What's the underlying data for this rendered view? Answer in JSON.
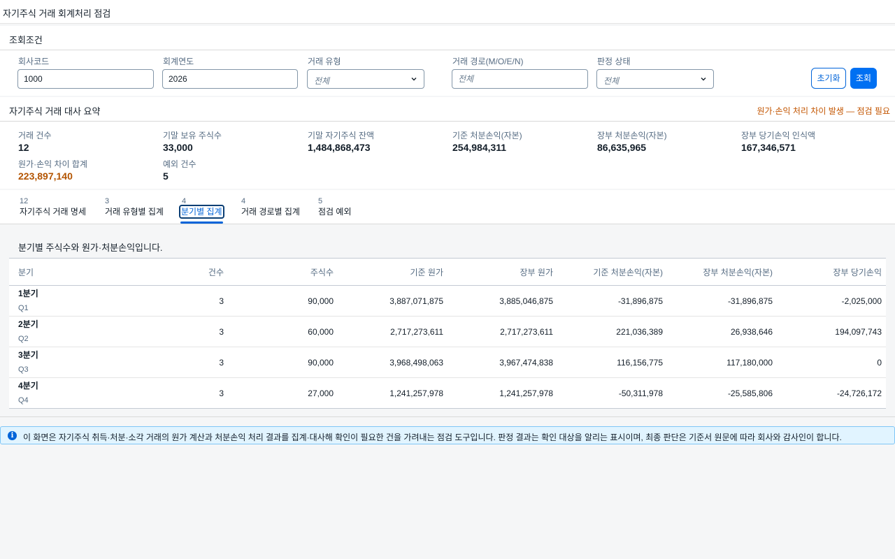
{
  "app": {
    "title": "자기주식 거래 회계처리 점검"
  },
  "filters": {
    "section_title": "조회조건",
    "company_code": {
      "label": "회사코드",
      "value": "1000"
    },
    "fiscal_year": {
      "label": "회계연도",
      "value": "2026"
    },
    "txn_type": {
      "label": "거래 유형",
      "value": "전체"
    },
    "txn_path": {
      "label": "거래 경로(M/O/E/N)",
      "placeholder": "전체"
    },
    "judgment_status": {
      "label": "판정 상태",
      "value": "전체"
    },
    "reset_label": "초기화",
    "search_label": "조회"
  },
  "summary": {
    "title": "자기주식 거래 대사 요약",
    "warning": "원가·손익 처리 차이 발생 — 점검 필요",
    "kpis": [
      {
        "label": "거래 건수",
        "value": "12"
      },
      {
        "label": "기말 보유 주식수",
        "value": "33,000"
      },
      {
        "label": "기말 자기주식 잔액",
        "value": "1,484,868,473"
      },
      {
        "label": "기준 처분손익(자본)",
        "value": "254,984,311"
      },
      {
        "label": "장부 처분손익(자본)",
        "value": "86,635,965"
      },
      {
        "label": "장부 당기손익 인식액",
        "value": "167,346,571"
      },
      {
        "label": "원가·손익 차이 합계",
        "value": "223,897,140"
      },
      {
        "label": "예외 건수",
        "value": "5"
      }
    ]
  },
  "tabs": [
    {
      "count": "12",
      "label": "자기주식 거래 명세"
    },
    {
      "count": "3",
      "label": "거래 유형별 집계"
    },
    {
      "count": "4",
      "label": "분기별 집계"
    },
    {
      "count": "4",
      "label": "거래 경로별 집계"
    },
    {
      "count": "5",
      "label": "점검 예외"
    }
  ],
  "selected_tab": 2,
  "quarter_table": {
    "description": "분기별 주식수와 원가·처분손익입니다.",
    "columns": [
      "분기",
      "건수",
      "주식수",
      "기준 원가",
      "장부 원가",
      "기준 처분손익(자본)",
      "장부 처분손익(자본)",
      "장부 당기손익"
    ],
    "rows": [
      {
        "quarter": "1분기",
        "code": "Q1",
        "count": "3",
        "shares": "90,000",
        "std_cost": "3,887,071,875",
        "book_cost": "3,885,046,875",
        "std_gain": "-31,896,875",
        "book_gain": "-31,896,875",
        "book_pl": "-2,025,000"
      },
      {
        "quarter": "2분기",
        "code": "Q2",
        "count": "3",
        "shares": "60,000",
        "std_cost": "2,717,273,611",
        "book_cost": "2,717,273,611",
        "std_gain": "221,036,389",
        "book_gain": "26,938,646",
        "book_pl": "194,097,743"
      },
      {
        "quarter": "3분기",
        "code": "Q3",
        "count": "3",
        "shares": "90,000",
        "std_cost": "3,968,498,063",
        "book_cost": "3,967,474,838",
        "std_gain": "116,156,775",
        "book_gain": "117,180,000",
        "book_pl": "0"
      },
      {
        "quarter": "4분기",
        "code": "Q4",
        "count": "3",
        "shares": "27,000",
        "std_cost": "1,241,257,978",
        "book_cost": "1,241,257,978",
        "std_gain": "-50,311,978",
        "book_gain": "-25,585,806",
        "book_pl": "-24,726,172"
      }
    ]
  },
  "info": {
    "icon": "info-icon",
    "message": "이 화면은 자기주식 취득·처분·소각 거래의 원가 계산과 처분손익 처리 결과를 집계·대사해 확인이 필요한 건을 가려내는 점검 도구입니다. 판정 결과는 확인 대상을 알리는 표시이며, 최종 판단은 기준서 원문에 따라 회사와 감사인이 합니다."
  },
  "colors": {
    "accent": "#0070f2",
    "warning": "#c35500",
    "info_bg": "#e1f4ff"
  }
}
